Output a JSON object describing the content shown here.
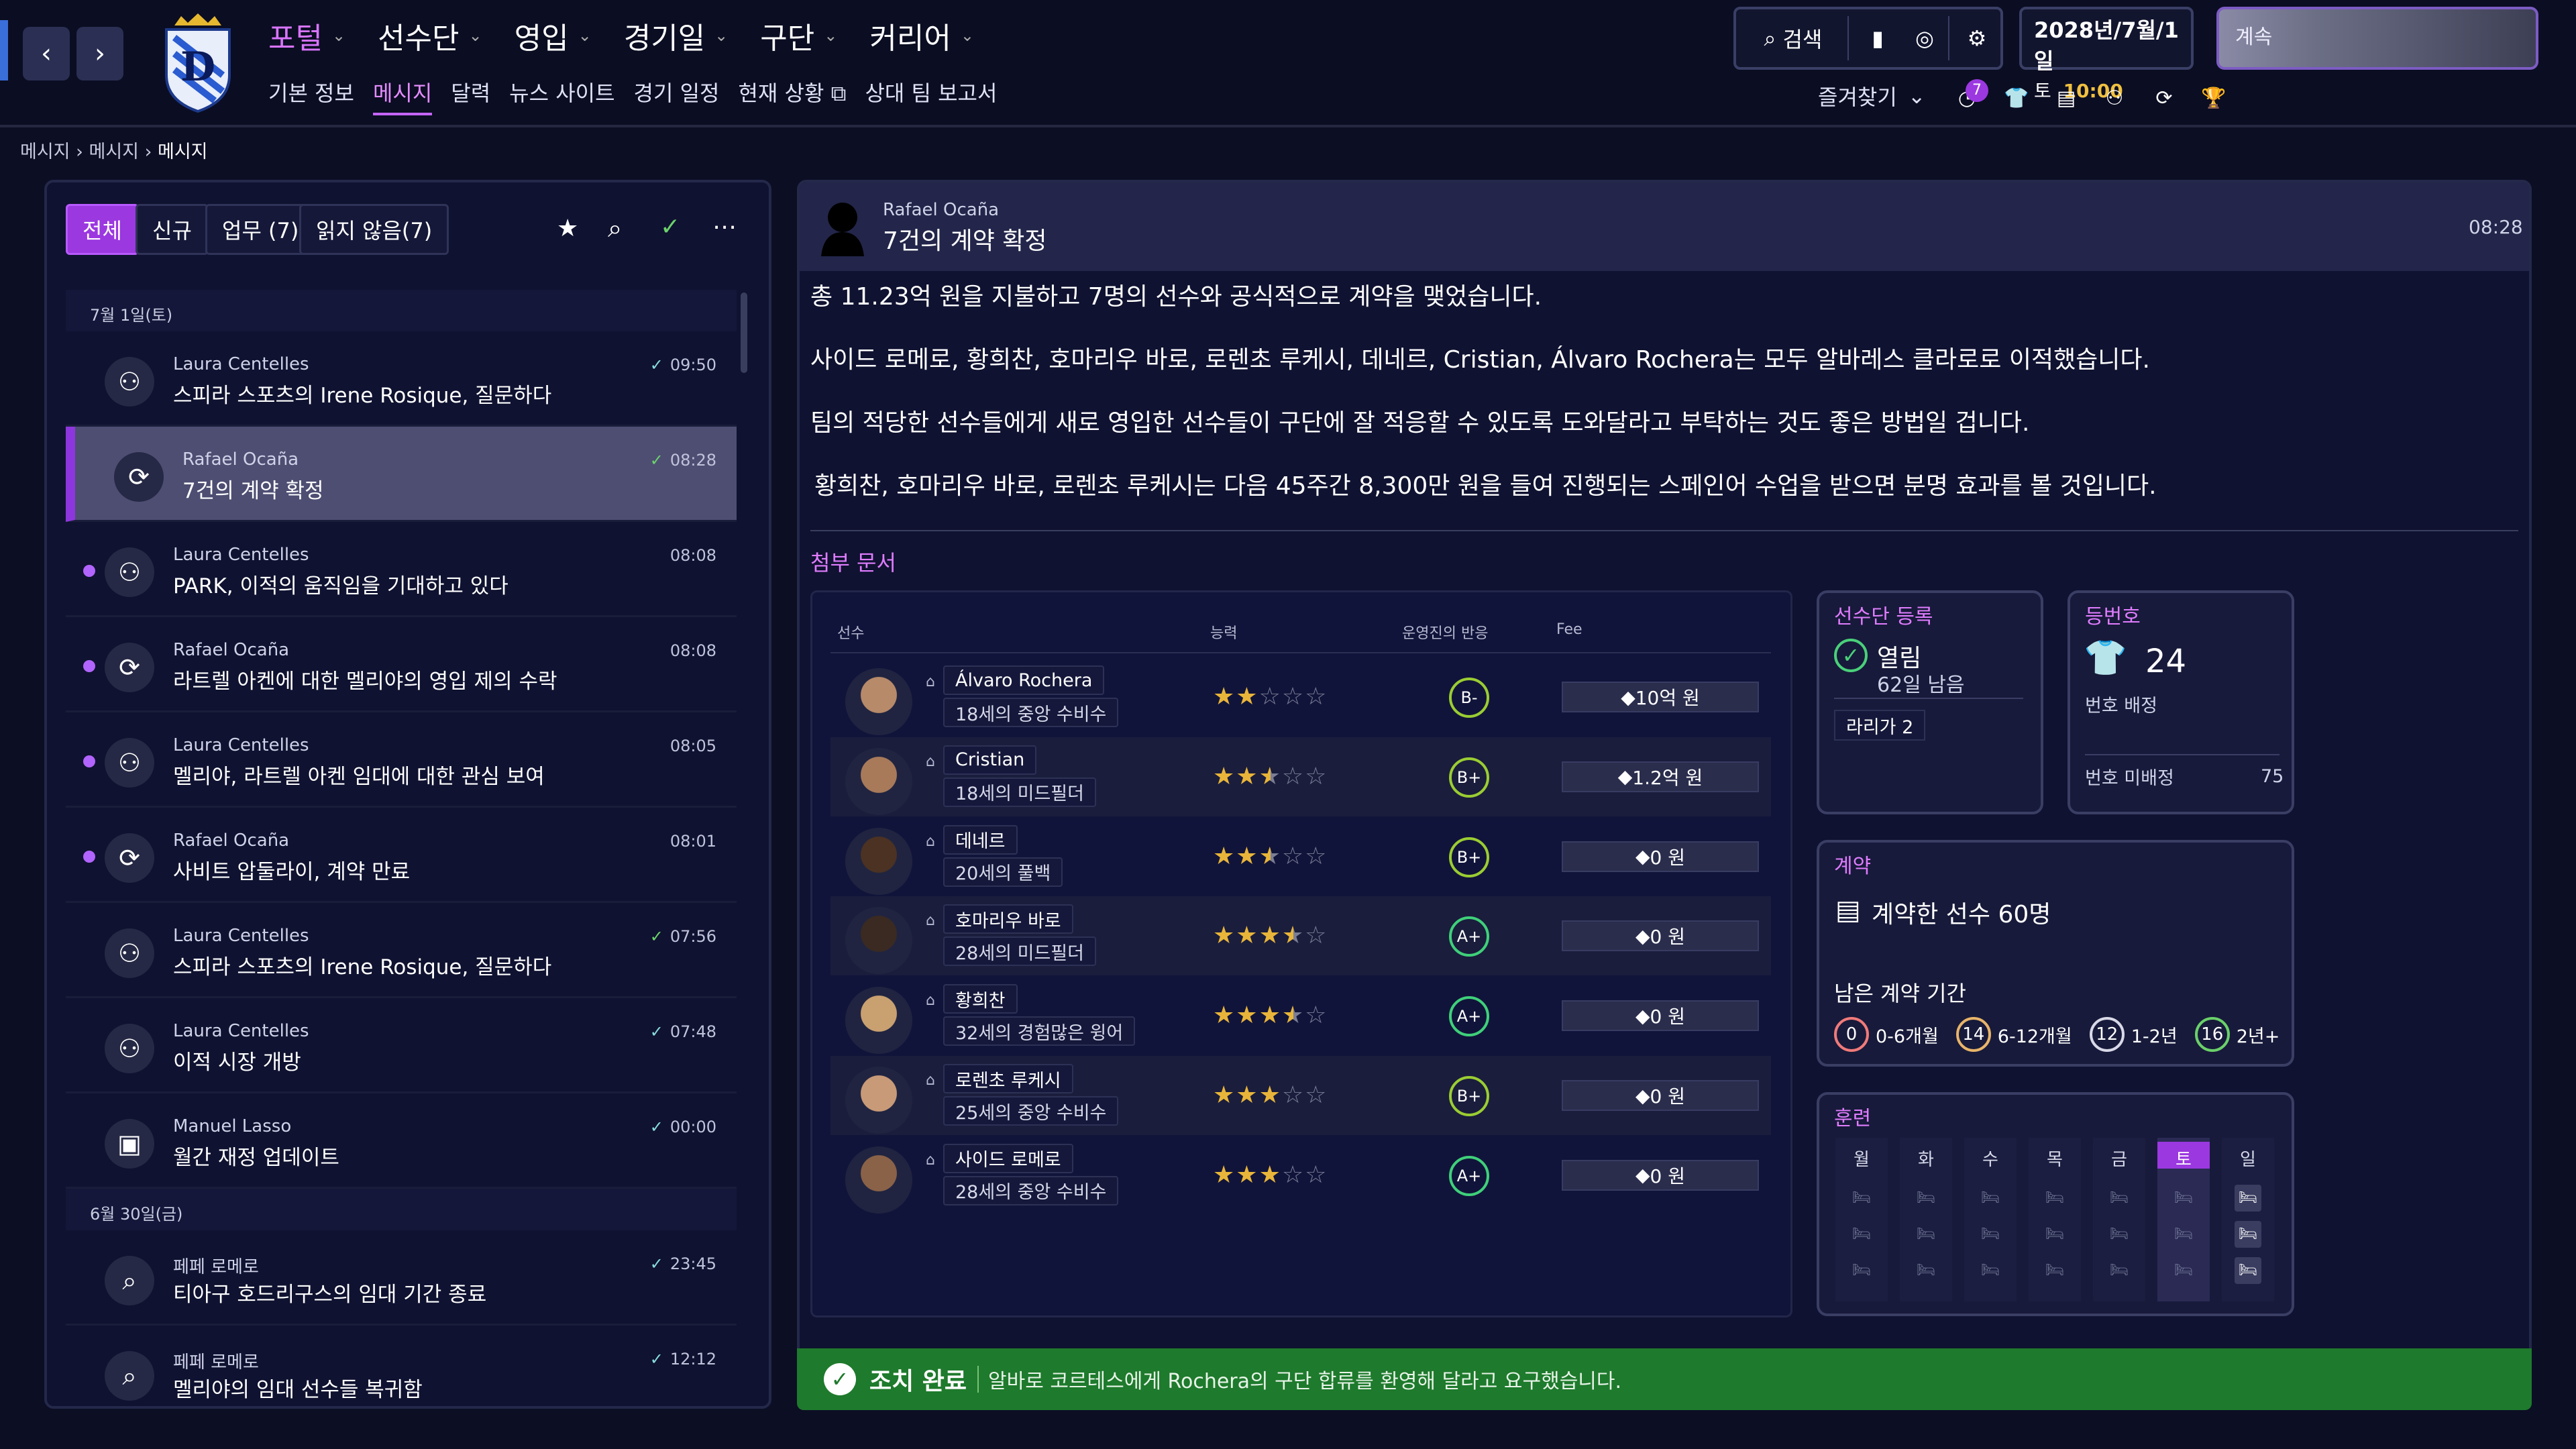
{
  "nav": {
    "main": [
      {
        "label": "포털",
        "active": true
      },
      {
        "label": "선수단"
      },
      {
        "label": "영입"
      },
      {
        "label": "경기일"
      },
      {
        "label": "구단"
      },
      {
        "label": "커리어"
      }
    ],
    "sub": [
      {
        "label": "기본 정보"
      },
      {
        "label": "메시지",
        "active": true
      },
      {
        "label": "달력"
      },
      {
        "label": "뉴스 사이트"
      },
      {
        "label": "경기 일정"
      },
      {
        "label": "현재 상황"
      },
      {
        "label": "상대 팀 보고서"
      }
    ],
    "search_label": "검색",
    "date": "2028년/7월/1일",
    "weekday": "토",
    "time": "10:00",
    "continue": "계속",
    "favorites": "즐겨찾기",
    "notify_count": "7"
  },
  "breadcrumb": [
    "메시지",
    "메시지",
    "메시지"
  ],
  "inbox": {
    "tabs": [
      "전체",
      "신규",
      "업무 (7)",
      "읽지 않음(7)"
    ],
    "day1": "7월 1일(토)",
    "day2": "6월 30일(금)",
    "messages": [
      {
        "from": "Laura Centelles",
        "text": "스피라 스포츠의 Irene Rosique, 질문하다",
        "time": "09:50",
        "icon": "people",
        "check": "read"
      },
      {
        "from": "Rafael Ocaña",
        "text": "7건의 계약 확정",
        "time": "08:28",
        "icon": "sync",
        "check": "done",
        "selected": true
      },
      {
        "from": "Laura Centelles",
        "text": "PARK, 이적의 움직임을 기대하고 있다",
        "time": "08:08",
        "icon": "people",
        "unread": true
      },
      {
        "from": "Rafael Ocaña",
        "text": "라트렐 아켄에 대한 멜리야의 영입 제의 수락",
        "time": "08:08",
        "icon": "sync",
        "unread": true
      },
      {
        "from": "Laura Centelles",
        "text": "멜리야, 라트렐 아켄 임대에 대한 관심 보여",
        "time": "08:05",
        "icon": "people",
        "unread": true
      },
      {
        "from": "Rafael Ocaña",
        "text": "사비트 압둘라이, 계약 만료",
        "time": "08:01",
        "icon": "sync",
        "unread": true
      },
      {
        "from": "Laura Centelles",
        "text": "스피라 스포츠의 Irene Rosique, 질문하다",
        "time": "07:56",
        "icon": "people",
        "check": "done"
      },
      {
        "from": "Laura Centelles",
        "text": "이적 시장 개방",
        "time": "07:48",
        "icon": "people",
        "check": "read"
      },
      {
        "from": "Manuel Lasso",
        "text": "월간 재정 업데이트",
        "time": "00:00",
        "icon": "briefcase",
        "check": "read"
      },
      {
        "from": "페페 로메로",
        "text": "티아구 호드리구스의 임대 기간 종료",
        "time": "23:45",
        "icon": "search",
        "check": "read"
      },
      {
        "from": "페페 로메로",
        "text": "멜리야의 임대 선수들 복귀함",
        "time": "12:12",
        "icon": "search",
        "check": "read"
      }
    ]
  },
  "detail": {
    "from": "Rafael Ocaña",
    "title": "7건의 계약 확정",
    "time": "08:28",
    "paragraphs": [
      "총 11.23억 원을 지불하고 7명의 선수와 공식적으로 계약을 맺었습니다.",
      "사이드 로메로, 황희찬, 호마리우 바로, 로렌초 루케시, 데네르, Cristian, Álvaro Rochera는 모두 알바레스 클라로로 이적했습니다.",
      "팀의 적당한 선수들에게 새로 영입한 선수들이 구단에 잘 적응할 수 있도록 도와달라고 부탁하는 것도 좋은 방법일 겁니다.",
      "황희찬, 호마리우 바로, 로렌초 루케시는 다음 45주간 8,300만 원을 들여 진행되는 스페인어 수업을 받으면 분명 효과를 볼 것입니다."
    ],
    "attach_label": "첨부 문서",
    "cols": [
      "선수",
      "능력",
      "운영진의 반응",
      "Fee"
    ],
    "players": [
      {
        "name": "Álvaro Rochera",
        "desc": "18세의 중앙 수비수",
        "stars": 2,
        "grade": "B-",
        "fee": "10억 원",
        "skin": "#b78a6a"
      },
      {
        "name": "Cristian",
        "desc": "18세의 미드필더",
        "stars": 2.5,
        "grade": "B+",
        "fee": "1.2억 원",
        "skin": "#a87a5a"
      },
      {
        "name": "데네르",
        "desc": "20세의 풀백",
        "stars": 2.5,
        "grade": "B+",
        "fee": "0 원",
        "skin": "#4b3223"
      },
      {
        "name": "호마리우 바로",
        "desc": "28세의 미드필더",
        "stars": 3.5,
        "grade": "A+",
        "fee": "0 원",
        "skin": "#3a2a22"
      },
      {
        "name": "황희찬",
        "desc": "32세의 경험많은 윙어",
        "stars": 3.5,
        "grade": "A+",
        "fee": "0 원",
        "skin": "#c9a070"
      },
      {
        "name": "로렌초 루케시",
        "desc": "25세의 중앙 수비수",
        "stars": 3,
        "grade": "B+",
        "fee": "0 원",
        "skin": "#c89a78"
      },
      {
        "name": "사이드 로메로",
        "desc": "28세의 중앙 수비수",
        "stars": 3,
        "grade": "A+",
        "fee": "0 원",
        "skin": "#8a6248"
      }
    ],
    "reg": {
      "title": "선수단 등록",
      "status": "열림",
      "remain": "62일 남음",
      "league": "라리가 2"
    },
    "num": {
      "title": "등번호",
      "value": "24",
      "assigned": "번호 배정",
      "unassigned": "번호 미배정",
      "unassigned_count": "75"
    },
    "contract": {
      "title": "계약",
      "signed": "계약한 선수 60명",
      "remain_label": "남은 계약 기간",
      "buckets": [
        {
          "n": "0",
          "l": "0-6개월",
          "c": "#f07a7a"
        },
        {
          "n": "14",
          "l": "6-12개월",
          "c": "#e8b46a"
        },
        {
          "n": "12",
          "l": "1-2년",
          "c": "#d8d8e8"
        },
        {
          "n": "16",
          "l": "2년+",
          "c": "#6ad06a"
        }
      ]
    },
    "training": {
      "title": "훈련",
      "days": [
        "월",
        "화",
        "수",
        "목",
        "금",
        "토",
        "일"
      ],
      "selected": 5
    },
    "footer": {
      "done": "조치 완료",
      "text": "알바로 코르테스에게 Rochera의 구단 합류를 환영해 달라고 요구했습니다."
    }
  }
}
